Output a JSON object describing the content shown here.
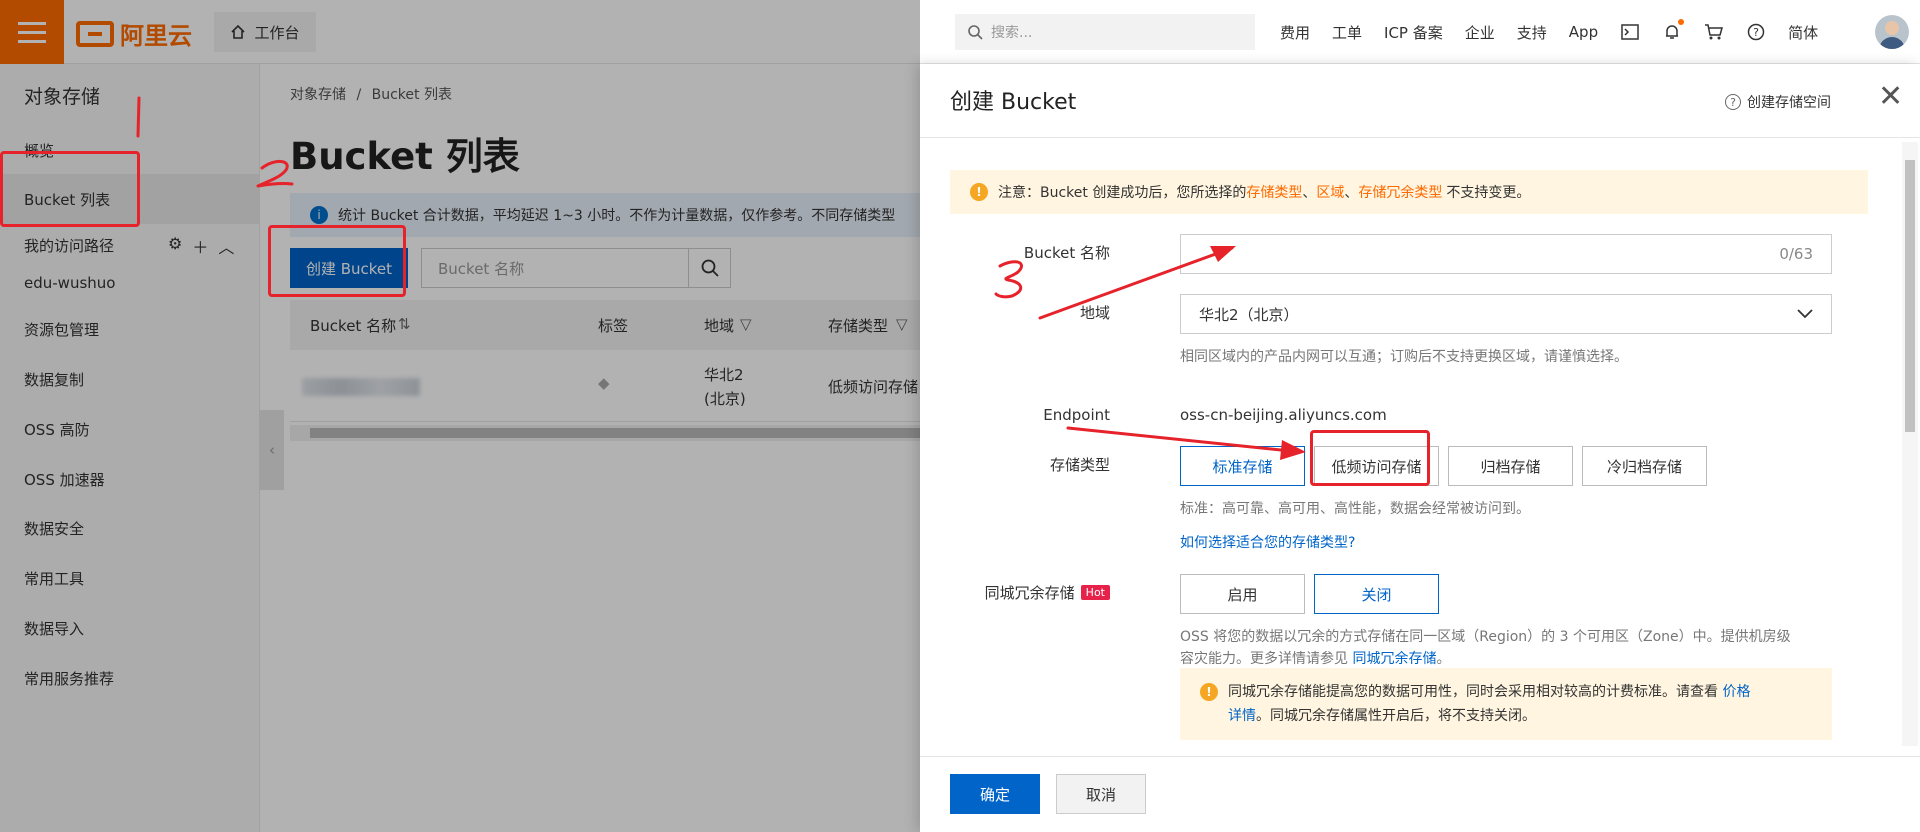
{
  "topbar": {
    "brand": "阿里云",
    "workbench": "工作台",
    "search_placeholder": "搜索...",
    "nav": [
      "费用",
      "工单",
      "ICP 备案",
      "企业",
      "支持",
      "App"
    ],
    "lang": "简体"
  },
  "sidebar": {
    "title": "对象存储",
    "items": [
      "概览",
      "Bucket 列表",
      "我的访问路径",
      "edu-wushuo",
      "资源包管理",
      "数据复制",
      "OSS 高防",
      "OSS 加速器",
      "数据安全",
      "常用工具",
      "数据导入",
      "常用服务推荐"
    ]
  },
  "main": {
    "breadcrumb": [
      "对象存储",
      "/",
      "Bucket 列表"
    ],
    "title": "Bucket 列表",
    "notice": "统计 Bucket 合计数据，平均延迟 1~3 小时。不作为计量数据，仅作参考。不同存储类型",
    "create_button": "创建 Bucket",
    "search_placeholder": "Bucket 名称",
    "columns": [
      "Bucket 名称",
      "标签",
      "地域",
      "存储类型"
    ],
    "row": {
      "region_line1": "华北2",
      "region_line2": "(北京)",
      "storage": "低频访问存储"
    }
  },
  "panel": {
    "title": "创建 Bucket",
    "help": "创建存储空间",
    "warning": {
      "prefix": "注意：Bucket 创建成功后，您所选择的",
      "t1": "存储类型",
      "sep1": "、",
      "t2": "区域",
      "sep2": "、",
      "t3": "存储冗余类型",
      "suffix": "不支持变更。"
    },
    "name_label": "Bucket 名称",
    "name_counter": "0/63",
    "region_label": "地域",
    "region_value": "华北2（北京）",
    "region_hint": "相同区域内的产品内网可以互通；订购后不支持更换区域，请谨慎选择。",
    "endpoint_label": "Endpoint",
    "endpoint_value": "oss-cn-beijing.aliyuncs.com",
    "storage_label": "存储类型",
    "storage_options": [
      "标准存储",
      "低频访问存储",
      "归档存储",
      "冷归档存储"
    ],
    "storage_hint": "标准：高可靠、高可用、高性能，数据会经常被访问到。",
    "storage_link": "如何选择适合您的存储类型?",
    "redundancy_label": "同城冗余存储",
    "hot": "Hot",
    "redundancy_options": [
      "启用",
      "关闭"
    ],
    "redundancy_hint_line1": "OSS 将您的数据以冗余的方式存储在同一区域（Region）的 3 个可用区（Zone）中。提供机房级",
    "redundancy_hint_line2": "容灾能力。更多详情请参见",
    "redundancy_link": "同城冗余存储",
    "redundancy_hint_end": "。",
    "warn2_line1": "同城冗余存储能提高您的数据可用性，同时会采用相对较高的计费标准。请查看",
    "warn2_link1": "价格",
    "warn2_link2": "详情",
    "warn2_line2": "。同城冗余存储属性开启后，将不支持关闭。",
    "ok": "确定",
    "cancel": "取消"
  },
  "colors": {
    "brand": "#ff6a00",
    "primary": "#0064c8",
    "annotation": "#e6222a"
  }
}
